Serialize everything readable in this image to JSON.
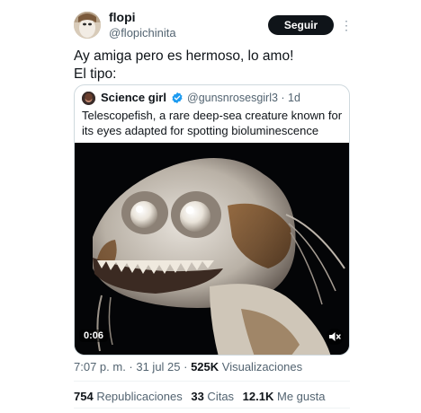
{
  "author": {
    "name": "flopi",
    "handle": "@flopichinita",
    "follow_label": "Seguir",
    "more_icon": "more-dots-icon"
  },
  "tweet": {
    "lines": [
      "Ay amiga pero es hermoso, lo amo!",
      "El tipo:"
    ]
  },
  "quote": {
    "name": "Science girl",
    "verified_color": "#1d9bf0",
    "meta": "@gunsnrosesgirl3 · 1d",
    "lines": [
      "Telescopefish, a rare deep-sea creature known for",
      "its eyes adapted for spotting bioluminescence"
    ],
    "video_duration": "0:06",
    "mute_icon": "speaker-muted-icon"
  },
  "meta": {
    "timestamp": "7:07 p. m. · 31 jul 25 · ",
    "views_count": "525K",
    "views_label": " Visualizaciones"
  },
  "stats": {
    "reposts_count": "754",
    "reposts_label": " Republicaciones",
    "quotes_count": "33",
    "quotes_label": " Citas",
    "likes_count": "12.1K",
    "likes_label": " Me gusta"
  }
}
